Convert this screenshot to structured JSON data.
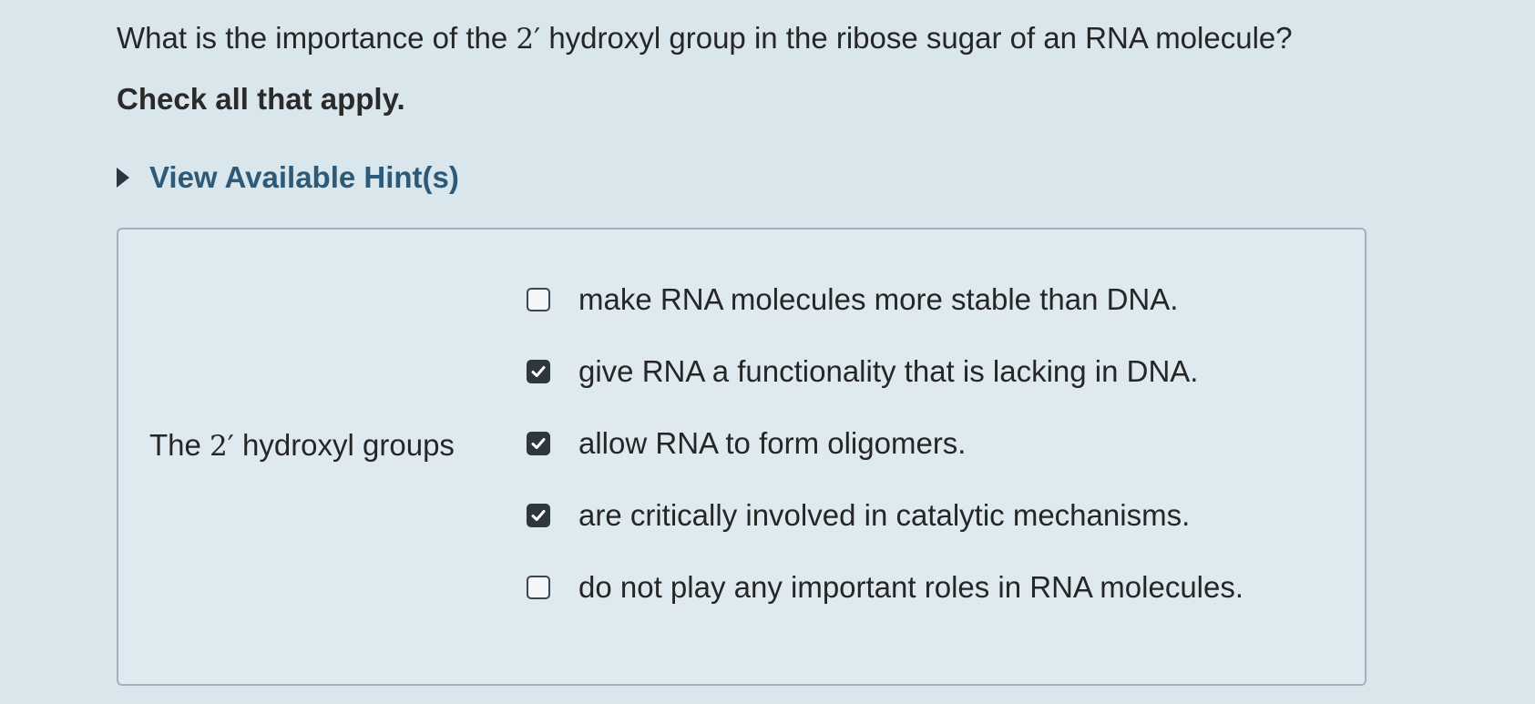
{
  "question": {
    "text_before": "What is the importance of the",
    "prime_value": "2′",
    "text_after": "hydroxyl group in the ribose sugar of an RNA molecule?"
  },
  "instruction": "Check all that apply.",
  "hint": {
    "label": "View Available Hint(s)",
    "icon": "caret-right-icon"
  },
  "stem": {
    "text_before": "The",
    "prime_value": "2′",
    "text_after": "hydroxyl groups"
  },
  "options": [
    {
      "label": "make RNA molecules more stable than DNA.",
      "checked": false
    },
    {
      "label": "give RNA a functionality that is lacking in DNA.",
      "checked": true
    },
    {
      "label": "allow RNA to form oligomers.",
      "checked": true
    },
    {
      "label": "are critically involved in catalytic mechanisms.",
      "checked": true
    },
    {
      "label": "do not play any important roles in RNA molecules.",
      "checked": false
    }
  ],
  "colors": {
    "background": "#d9e6ec",
    "hint_link": "#2c5a78",
    "checkbox_checked": "#2f363e"
  }
}
